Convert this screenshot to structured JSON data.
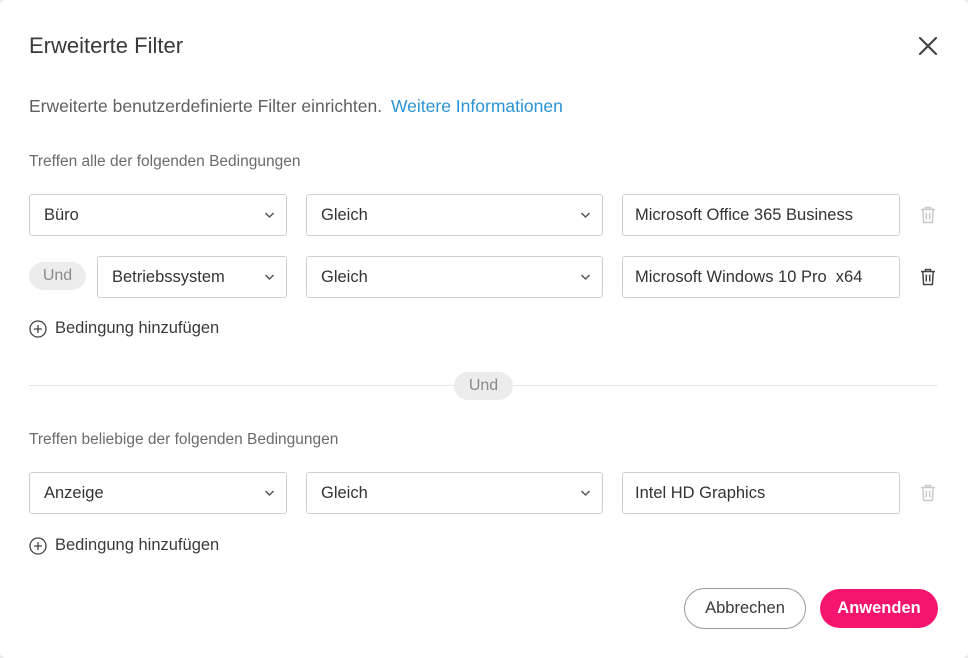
{
  "dialog": {
    "title": "Erweiterte Filter",
    "intro_text": "Erweiterte benutzerdefinierte Filter einrichten.",
    "intro_link": "Weitere Informationen"
  },
  "group_all": {
    "label": "Treffen alle der folgenden Bedingungen",
    "rows": [
      {
        "field": "Büro",
        "operator": "Gleich",
        "value": "Microsoft Office 365 Business",
        "trash_enabled": false
      },
      {
        "connector": "Und",
        "field": "Betriebssystem",
        "operator": "Gleich",
        "value": "Microsoft Windows 10 Pro  x64",
        "trash_enabled": true
      }
    ],
    "add_label": "Bedingung hinzufügen"
  },
  "group_connector": "Und",
  "group_any": {
    "label": "Treffen beliebige der folgenden Bedingungen",
    "rows": [
      {
        "field": "Anzeige",
        "operator": "Gleich",
        "value": "Intel HD Graphics",
        "trash_enabled": false
      }
    ],
    "add_label": "Bedingung hinzufügen"
  },
  "footer": {
    "cancel_label": "Abbrechen",
    "apply_label": "Anwenden"
  },
  "colors": {
    "accent": "#f5156e",
    "link": "#2a94d6",
    "trash_disabled": "#c8c8c8",
    "trash_enabled": "#444444"
  },
  "icons": [
    "close-icon",
    "chevron-down-icon",
    "trash-icon",
    "plus-circle-icon"
  ]
}
